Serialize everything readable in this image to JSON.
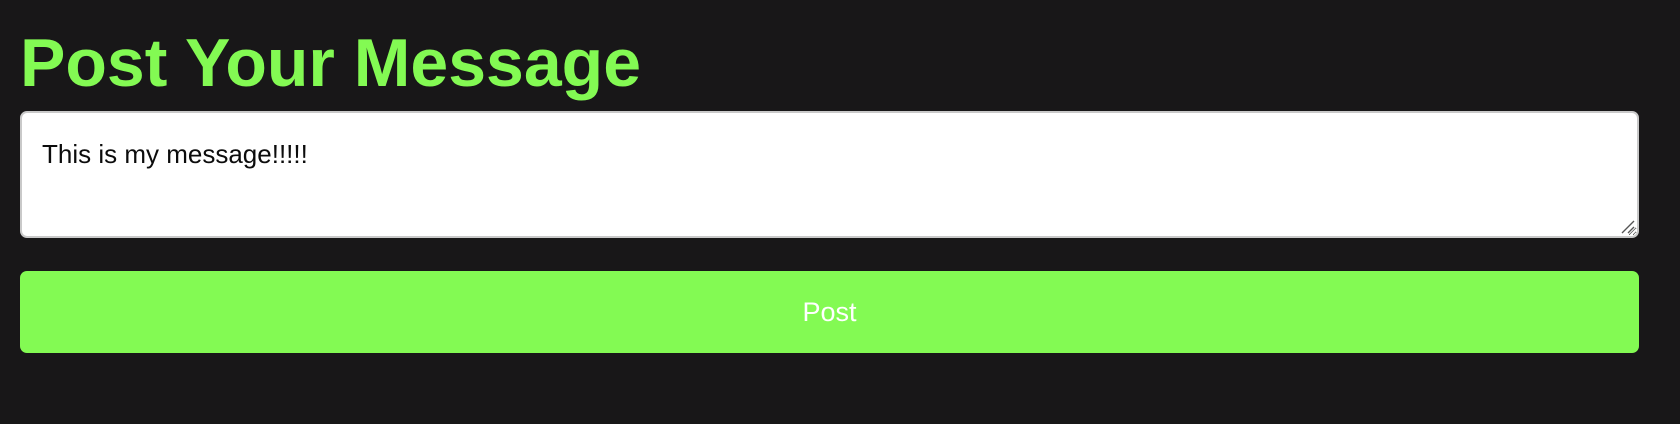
{
  "page": {
    "title": "Post Your Message"
  },
  "form": {
    "message_value": "This is my message!!!!!",
    "post_label": "Post"
  },
  "colors": {
    "background": "#181718",
    "accent": "#83fa53",
    "textarea_bg": "#ffffff",
    "button_text": "#ffffff"
  },
  "icons": {
    "resize": "resize-grip-icon"
  }
}
